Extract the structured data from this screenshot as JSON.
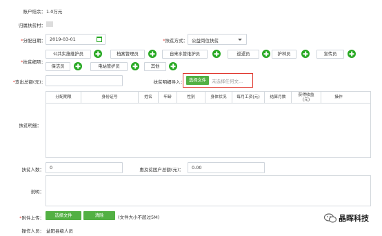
{
  "account_balance": {
    "label": "账户结余：",
    "value": "1.0万元"
  },
  "village": {
    "label": "归属扶贫村：",
    "value": ""
  },
  "distribution_date": {
    "label": "分配日期：",
    "required": "*",
    "value": "2019-03-01"
  },
  "method": {
    "label": "扶贫方式：",
    "required": "*",
    "value": "公益岗位扶贫"
  },
  "items": {
    "label": "扶贫细项：",
    "required": "*",
    "tags": [
      "公共实施维护员",
      "档案管理员",
      "自来水管维护员",
      "巡逻员",
      "护林员",
      "宣传员",
      "保洁员",
      "电站管护员",
      "其他"
    ]
  },
  "total": {
    "label": "支出总额(元)：",
    "required": "*",
    "value": ""
  },
  "import": {
    "label": "扶贫明细导入：",
    "button": "选择文件",
    "placeholder": "未选择任何文..."
  },
  "detail": {
    "label": "扶贫明细：",
    "columns": [
      "分配期限",
      "身份证号",
      "姓名",
      "年龄",
      "性别",
      "身体状况",
      "每月工资(元)",
      "结算月数",
      "获得收益\n(元)",
      "操作"
    ]
  },
  "beneficiary_count": {
    "label": "扶贫人数：",
    "value": "0"
  },
  "household_total": {
    "label": "惠及贫困户总额(元)：",
    "value": "0.00"
  },
  "note": {
    "label": "说明：",
    "value": ""
  },
  "attachment": {
    "label": "附件上传：",
    "required": "*",
    "choose_button": "选择文件",
    "clear_button": "清除",
    "hint": "(文件大小不超过5M)"
  },
  "operator": {
    "label": "操作人员：",
    "value": "益阳县级人员"
  },
  "watermark": {
    "brand": "晶晖科技"
  },
  "colors": {
    "accent_green": "#52b043",
    "highlight_red": "#e0382f",
    "required_red": "#e0382f"
  }
}
